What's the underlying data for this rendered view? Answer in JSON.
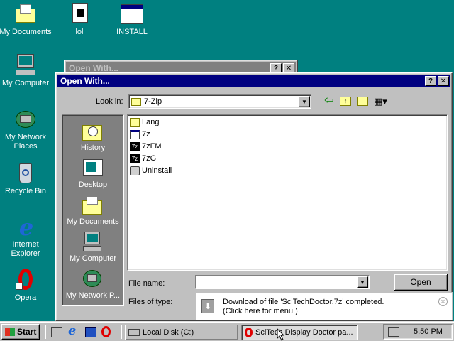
{
  "desktop": {
    "icons": [
      {
        "label": "My Documents",
        "icon": "my-documents-icon"
      },
      {
        "label": "lol",
        "icon": "document-icon"
      },
      {
        "label": "INSTALL",
        "icon": "window-icon"
      },
      {
        "label": "My Computer",
        "icon": "my-computer-icon"
      },
      {
        "label": "My Network Places",
        "icon": "network-icon"
      },
      {
        "label": "Recycle Bin",
        "icon": "recycle-bin-icon"
      },
      {
        "label": "Internet Explorer",
        "icon": "internet-explorer-icon"
      },
      {
        "label": "Opera",
        "icon": "opera-icon"
      }
    ]
  },
  "bg_window": {
    "title": "Open With..."
  },
  "dialog": {
    "title": "Open With...",
    "look_in_label": "Look in:",
    "look_in_value": "7-Zip",
    "places": [
      {
        "label": "History",
        "icon": "history-icon"
      },
      {
        "label": "Desktop",
        "icon": "desktop-icon"
      },
      {
        "label": "My Documents",
        "icon": "my-documents-icon"
      },
      {
        "label": "My Computer",
        "icon": "my-computer-icon"
      },
      {
        "label": "My Network P...",
        "icon": "network-icon"
      }
    ],
    "files": [
      {
        "name": "Lang",
        "icon": "folder-icon"
      },
      {
        "name": "7z",
        "icon": "app-icon"
      },
      {
        "name": "7zFM",
        "icon": "7z-icon"
      },
      {
        "name": "7zG",
        "icon": "7z-icon"
      },
      {
        "name": "Uninstall",
        "icon": "uninstall-icon"
      }
    ],
    "file_name_label": "File name:",
    "file_name_value": "",
    "files_of_type_label": "Files of type:",
    "open_label": "Open"
  },
  "notification": {
    "line1": "Download of file 'SciTechDoctor.7z' completed.",
    "line2": "(Click here for menu.)"
  },
  "taskbar": {
    "start_label": "Start",
    "tasks": [
      {
        "label": "Local Disk (C:)"
      },
      {
        "label": "SciTech Display Doctor pa..."
      }
    ],
    "time": "5:50 PM"
  },
  "colors": {
    "desktop": "#008080",
    "titlebar_active": "#000080",
    "titlebar_inactive": "#808080",
    "face": "#c0c0c0"
  }
}
